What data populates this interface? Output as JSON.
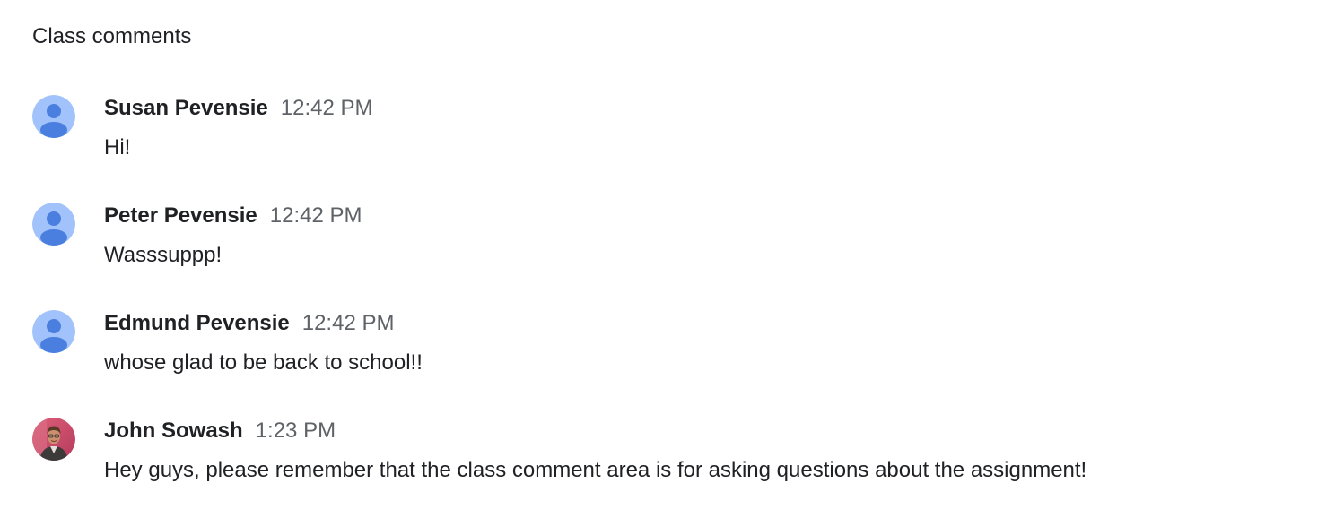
{
  "section": {
    "title": "Class comments"
  },
  "comments": [
    {
      "author": "Susan Pevensie",
      "time": "12:42 PM",
      "text": "Hi!",
      "avatar_icon": "default-person-icon"
    },
    {
      "author": "Peter Pevensie",
      "time": "12:42 PM",
      "text": "Wasssuppp!",
      "avatar_icon": "default-person-icon"
    },
    {
      "author": "Edmund Pevensie",
      "time": "12:42 PM",
      "text": "whose glad to be back to school!!",
      "avatar_icon": "default-person-icon"
    },
    {
      "author": "John Sowash",
      "time": "1:23 PM",
      "text": "Hey guys, please remember that the class comment area is for asking questions about the assignment!",
      "avatar_icon": "profile-photo"
    }
  ],
  "colors": {
    "default_avatar_bg": "#a1c2fa",
    "default_avatar_fg": "#4a7fe0",
    "time_text": "#5f6368",
    "primary_text": "#202124"
  }
}
